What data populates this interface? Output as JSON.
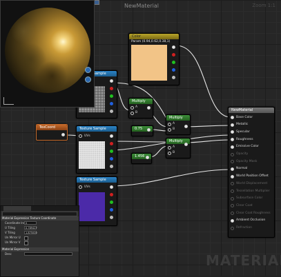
{
  "app": {
    "title": "NewMaterial",
    "zoom": "Zoom 1:1",
    "watermark": "MATERIAL"
  },
  "nodes": {
    "color": {
      "header": "Color",
      "subtitle": "Param (0.94,0.62,0.38,1)"
    },
    "tex1": {
      "header": "Texture Sample"
    },
    "tex2": {
      "header": "Texture Sample",
      "uv_label": "UVs"
    },
    "tex3": {
      "header": "Texture Sample",
      "uv_label": "UVs"
    },
    "texcoord": {
      "header": "TexCoord"
    },
    "multiply1": {
      "header": "Multiply",
      "a": "A",
      "b": "B"
    },
    "multiply2": {
      "header": "Multiply",
      "a": "A",
      "b": "B"
    },
    "multiply3": {
      "header": "Multiply",
      "a": "A",
      "b": "B"
    },
    "const1": {
      "header": "0.75"
    },
    "const2": {
      "header": "1.456"
    },
    "material": {
      "header": "NewMaterial",
      "inputs": [
        {
          "label": "Base Color",
          "active": true
        },
        {
          "label": "Metallic",
          "active": true
        },
        {
          "label": "Specular",
          "active": true
        },
        {
          "label": "Roughness",
          "active": true
        },
        {
          "label": "Emissive Color",
          "active": true
        },
        {
          "label": "Opacity",
          "active": false
        },
        {
          "label": "Opacity Mask",
          "active": false
        },
        {
          "label": "Normal",
          "active": true
        },
        {
          "label": "World Position Offset",
          "active": true
        },
        {
          "label": "World Displacement",
          "active": false
        },
        {
          "label": "Tessellation Multiplier",
          "active": false
        },
        {
          "label": "Subsurface Color",
          "active": false
        },
        {
          "label": "Clear Coat",
          "active": false
        },
        {
          "label": "Clear Coat Roughness",
          "active": false
        },
        {
          "label": "Ambient Occlusion",
          "active": true
        },
        {
          "label": "Refraction",
          "active": false
        }
      ]
    }
  },
  "details": {
    "tab_label": "Details",
    "section1": "Material Expression Texture Coordinate",
    "rows": [
      {
        "label": "Coordinate Index",
        "value": "0"
      },
      {
        "label": "U Tiling",
        "value": "0.789427"
      },
      {
        "label": "V Tiling",
        "value": "1.875000"
      },
      {
        "label": "Un Mirror U",
        "value": ""
      },
      {
        "label": "Un Mirror V",
        "value": ""
      }
    ],
    "section2": "Material Expression",
    "desc_label": "Desc"
  },
  "colors": {
    "color_swatch": "#f2c487",
    "tex3_swatch": "#4b2aa8",
    "material_header": "#7a7a7a"
  }
}
